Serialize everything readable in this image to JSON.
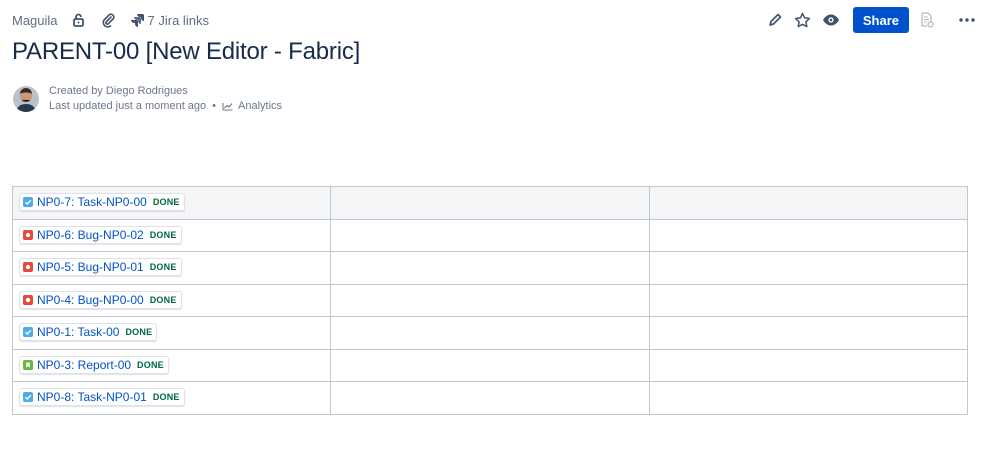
{
  "breadcrumb": {
    "space": "Maguila"
  },
  "topbar": {
    "jira_links": "7 Jira links"
  },
  "actions": {
    "share_label": "Share"
  },
  "page": {
    "title": "PARENT-00 [New Editor - Fabric]",
    "created_by": "Created by Diego Rodrigues",
    "last_updated": "Last updated just a moment ago",
    "separator": "•",
    "analytics": "Analytics"
  },
  "colors": {
    "task": "#4bade8",
    "bug": "#e5493a",
    "story": "#63ba3c",
    "status_done": "#006644",
    "link": "#0052cc"
  },
  "table": {
    "rows": [
      {
        "type": "task",
        "key": "NP0-7: Task-NP0-00",
        "status": "DONE"
      },
      {
        "type": "bug",
        "key": "NP0-6: Bug-NP0-02",
        "status": "DONE"
      },
      {
        "type": "bug",
        "key": "NP0-5: Bug-NP0-01",
        "status": "DONE"
      },
      {
        "type": "bug",
        "key": "NP0-4: Bug-NP0-00",
        "status": "DONE"
      },
      {
        "type": "task",
        "key": "NP0-1: Task-00",
        "status": "DONE"
      },
      {
        "type": "story",
        "key": "NP0-3: Report-00",
        "status": "DONE"
      },
      {
        "type": "task",
        "key": "NP0-8: Task-NP0-01",
        "status": "DONE"
      }
    ]
  }
}
